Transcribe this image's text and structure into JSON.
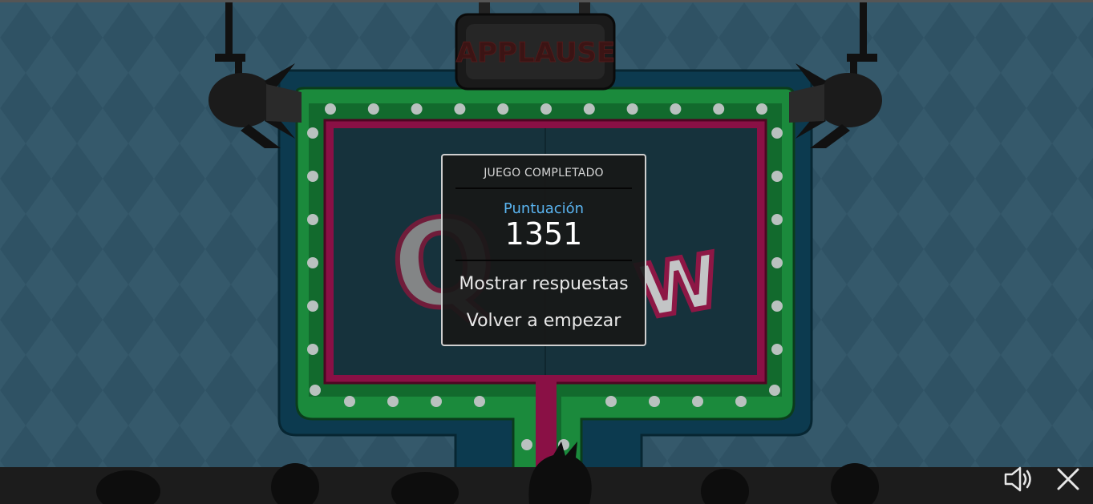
{
  "stage": {
    "applause_sign": "APPLAUSE",
    "show_logo_fragments": [
      "Q",
      "W"
    ],
    "colors": {
      "wall": "#35596b",
      "wall_diamond": "#2f5163",
      "board_outer": "#0c3a4f",
      "board_green": "#1b8a3c",
      "board_magenta": "#8a1045",
      "board_screen": "#16323c",
      "bulb": "#b9c1bf",
      "audience": "#0d0d0d"
    }
  },
  "dialog": {
    "title": "JUEGO COMPLETADO",
    "score_label": "Puntuación",
    "score_value": "1351",
    "show_answers_label": "Mostrar respuestas",
    "restart_label": "Volver a empezar"
  },
  "controls": {
    "sound_icon": "speaker-icon",
    "close_icon": "close-icon"
  }
}
